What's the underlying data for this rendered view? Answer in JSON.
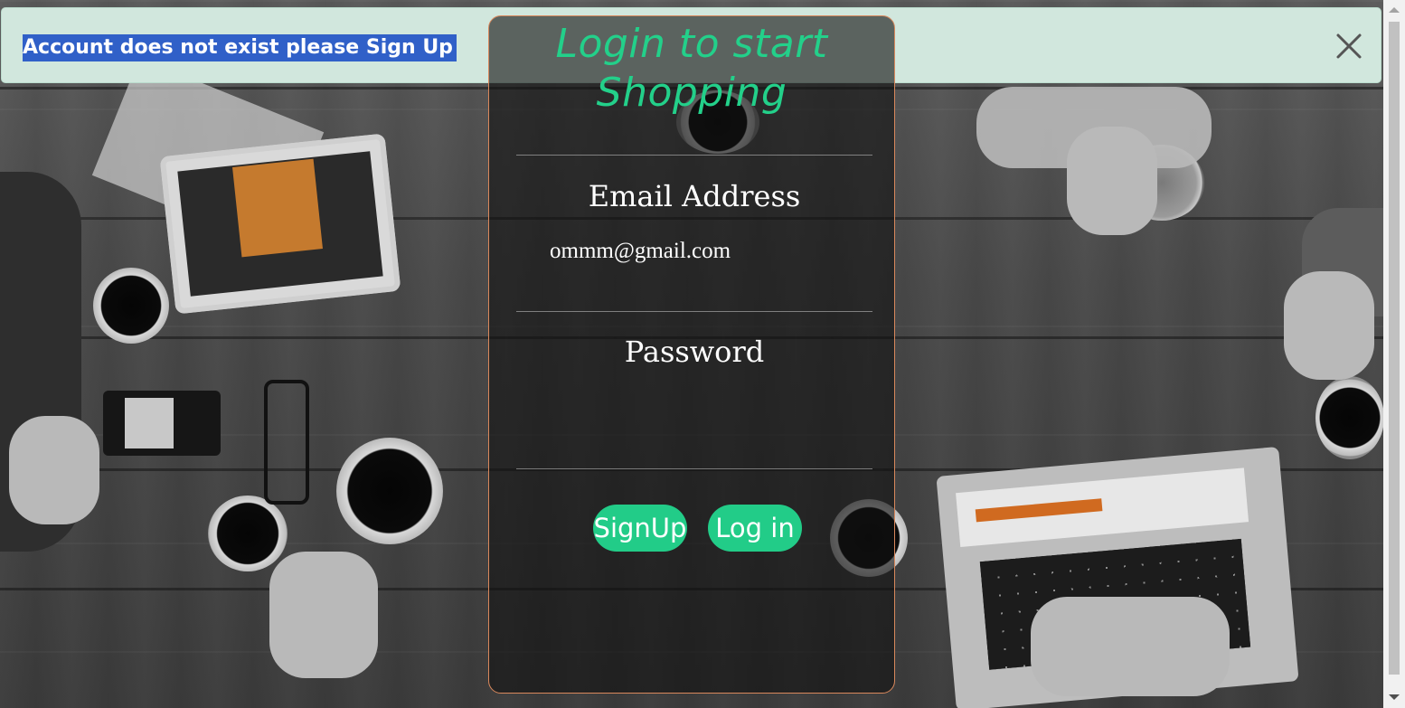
{
  "alert": {
    "message": "Account does not exist please Sign Up",
    "close_icon": "close-icon"
  },
  "login_card": {
    "title": "Login to start Shopping",
    "email_label": "Email Address",
    "email_value": "ommm@gmail.com",
    "password_label": "Password",
    "password_value": "",
    "signup_label": "SignUp",
    "login_label": "Log in"
  },
  "colors": {
    "accent": "#22cc88",
    "alert_bg": "#d1e7dd",
    "selection": "#3060c8",
    "card_border": "#d9885c"
  }
}
